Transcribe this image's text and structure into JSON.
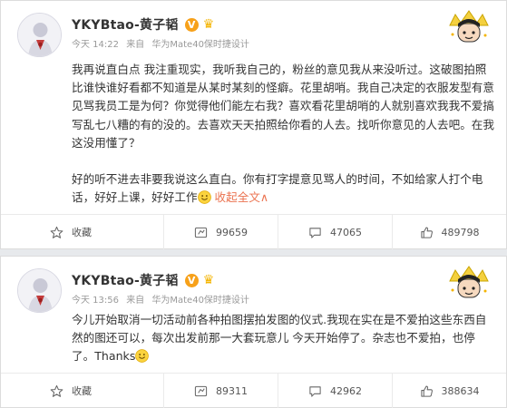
{
  "posts": [
    {
      "username": "YKYBtao-黄子韬",
      "verified_badge": "V",
      "timestamp": "今天 14:22",
      "source_prefix": "来自",
      "source_device": "华为Mate40保时捷设计",
      "paragraph1": "我再说直白点 我注重现实，我听我自己的，粉丝的意见我从来没听过。这破图拍照比谁快谁好看都不知道是从某时某刻的怪癖。花里胡哨。我自己决定的衣服发型有意见骂我员工是为何？你觉得他们能左右我？喜欢看花里胡哨的人就别喜欢我我不爱搞写乱七八糟的有的没的。去喜欢天天拍照给你看的人去。找听你意见的人去吧。在我这没用懂了？",
      "paragraph2": "好的听不进去非要我说这么直白。你有打字提意见骂人的时间，不如给家人打个电话，好好上课，好好工作",
      "expand_label": "收起全文",
      "expand_arrow": "∧",
      "actions": {
        "favorite": "收藏",
        "repost": "99659",
        "comment": "47065",
        "like": "489798"
      }
    },
    {
      "username": "YKYBtao-黄子韬",
      "verified_badge": "V",
      "timestamp": "今天 13:56",
      "source_prefix": "来自",
      "source_device": "华为Mate40保时捷设计",
      "paragraph1": "今儿开始取消一切活动前各种拍图摆拍发图的仪式.我现在实在是不爱拍这些东西自然的图还可以，每次出发前那一大套玩意儿 今天开始停了。杂志也不爱拍，也停了。Thanks",
      "actions": {
        "favorite": "收藏",
        "repost": "89311",
        "comment": "42962",
        "like": "388634"
      }
    }
  ],
  "colors": {
    "accent_orange": "#eb7350",
    "badge_orange": "#f7a11a",
    "meta_gray": "#999999",
    "text": "#333333"
  }
}
